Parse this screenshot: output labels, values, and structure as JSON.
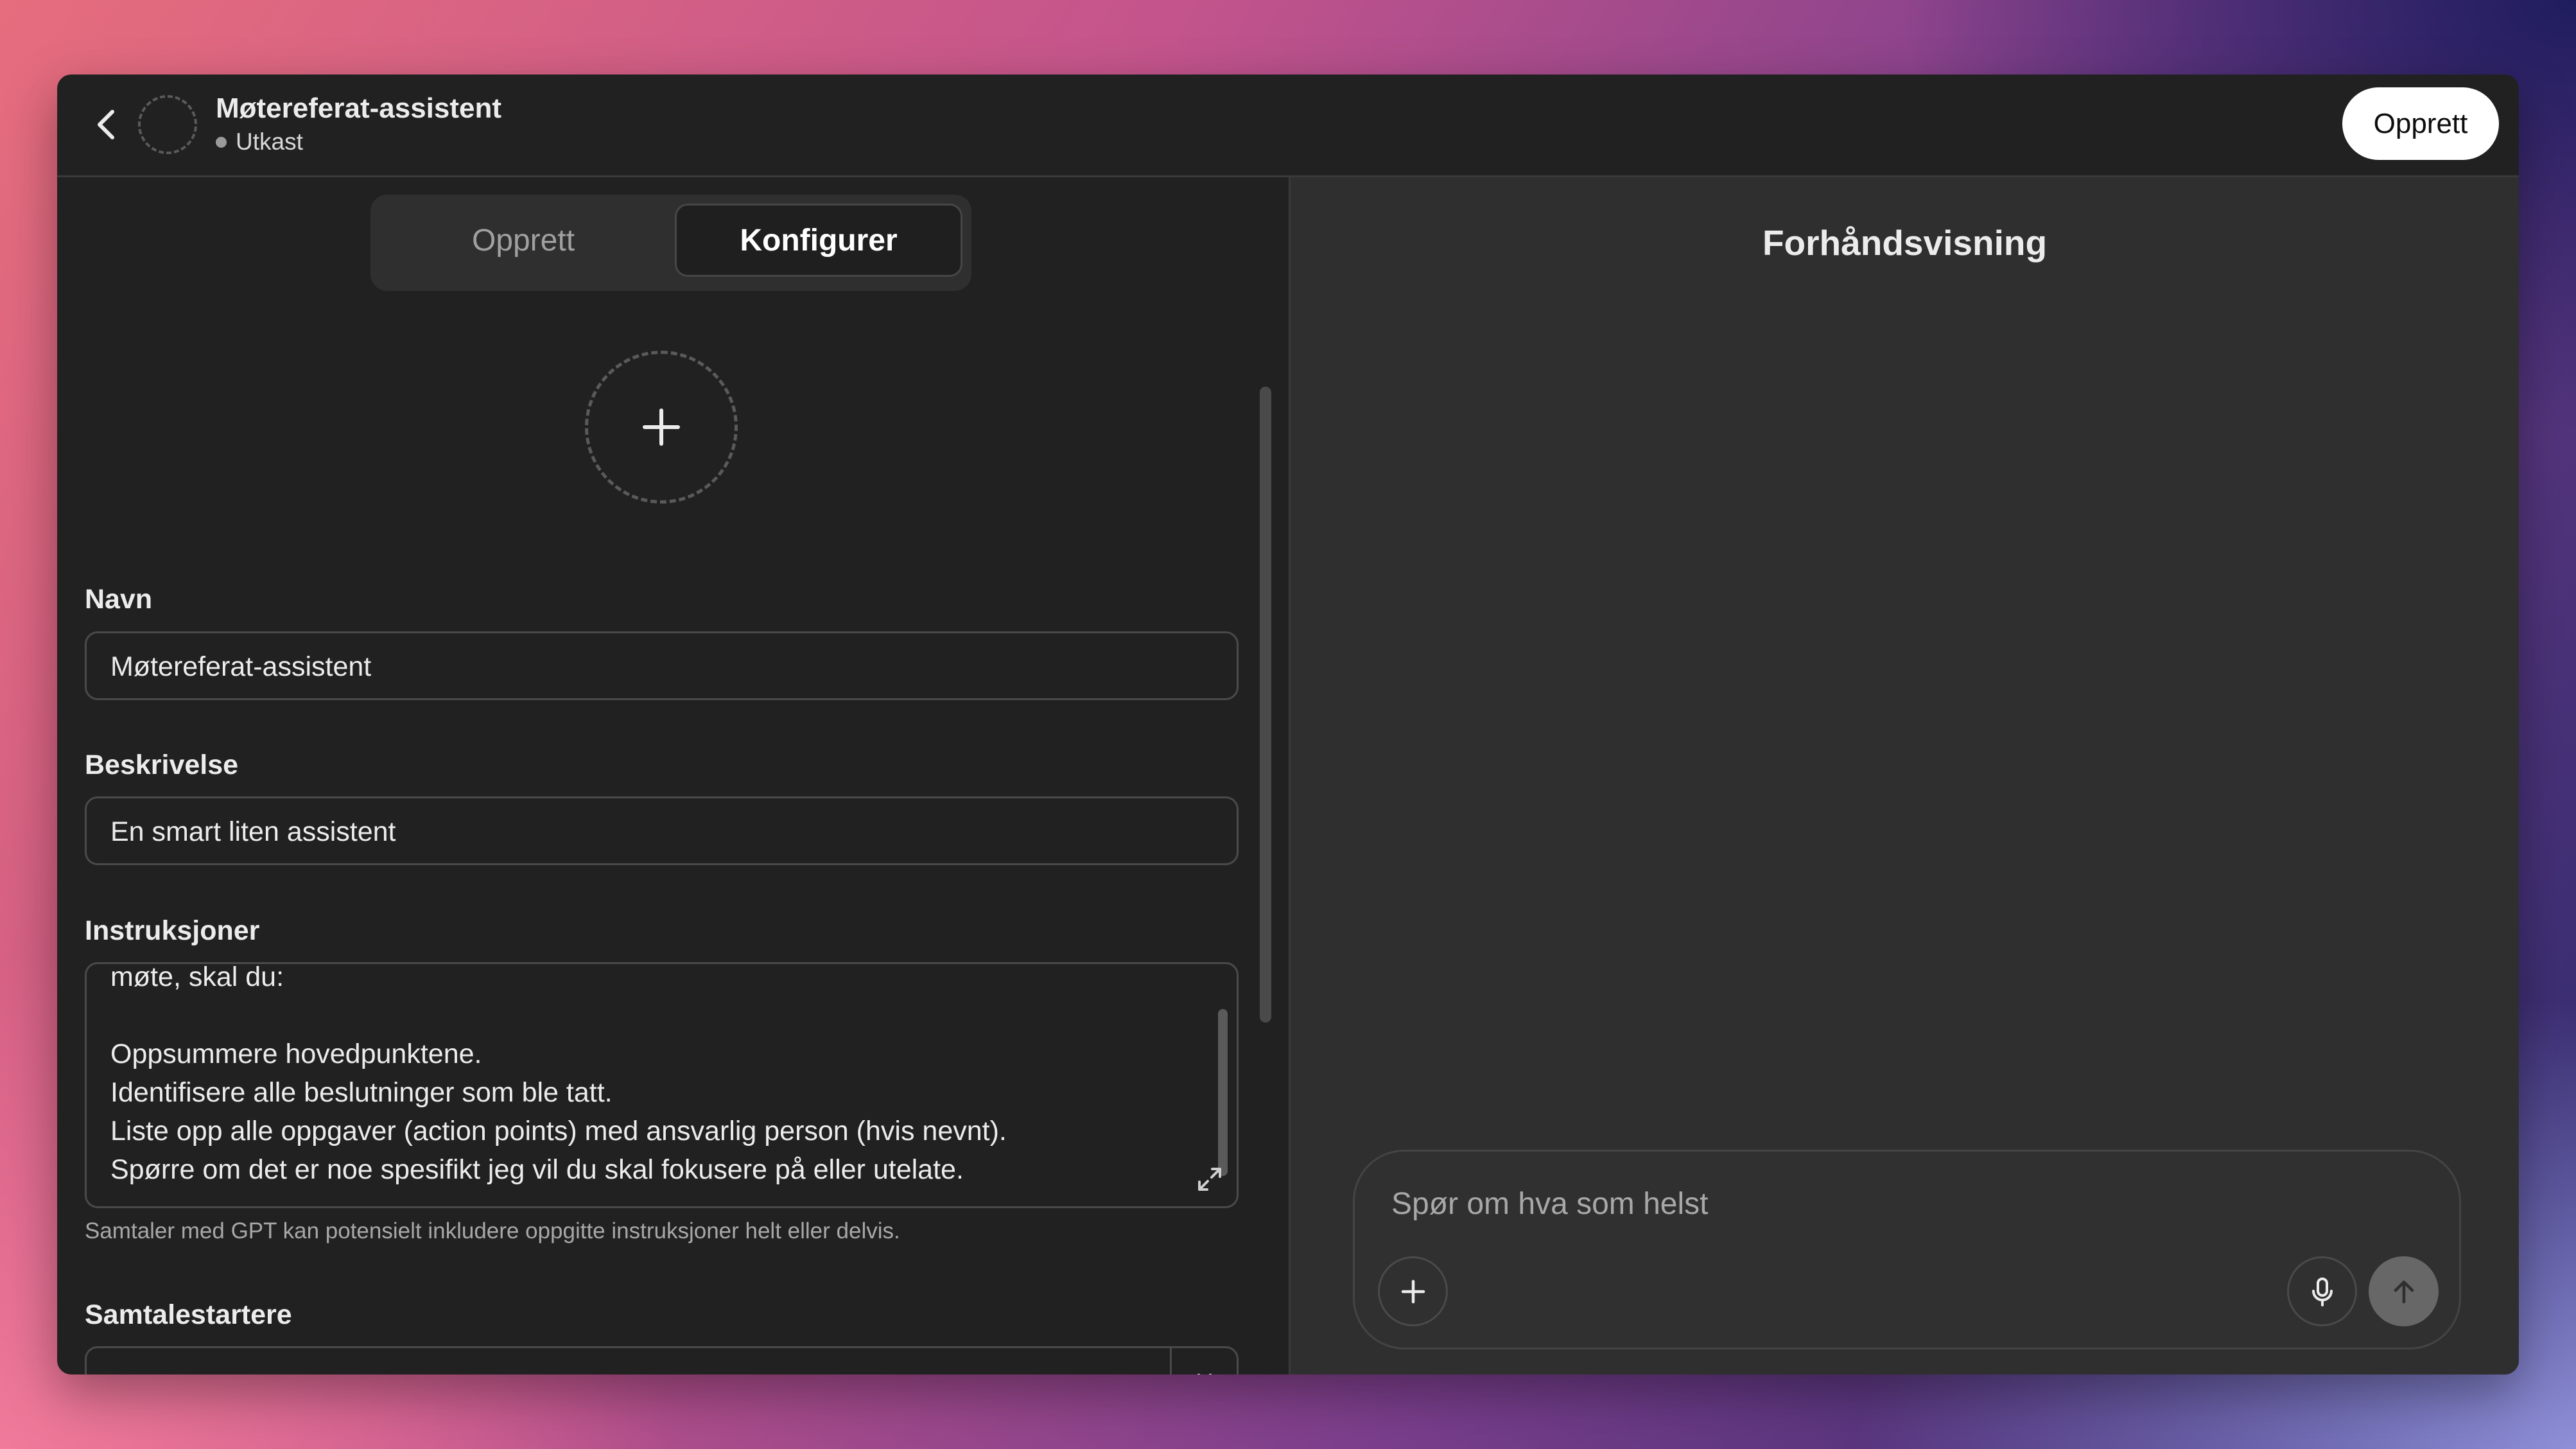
{
  "header": {
    "gpt_name": "Møtereferat-assistent",
    "status": "Utkast",
    "publish_label": "Opprett"
  },
  "tabs": {
    "create_label": "Opprett",
    "configure_label": "Konfigurer",
    "active": "Konfigurer"
  },
  "form": {
    "name_label": "Navn",
    "name_value": "Møtereferat-assistent",
    "description_label": "Beskrivelse",
    "description_value": "En smart liten assistent",
    "instructions_label": "Instruksjoner",
    "instructions_lines": [
      "møte, skal du:",
      "",
      "Oppsummere hovedpunktene.",
      "Identifisere alle beslutninger som ble tatt.",
      "Liste opp alle oppgaver (action points) med ansvarlig person (hvis nevnt).",
      "Spørre om det er noe spesifikt jeg vil du skal fokusere på eller utelate."
    ],
    "instructions_hint": "Samtaler med GPT kan potensielt inkludere oppgitte instruksjoner helt eller delvis.",
    "starters_label": "Samtalestartere",
    "starter_value": ""
  },
  "preview": {
    "title": "Forhåndsvisning",
    "composer_placeholder": "Spør om hva som helst"
  },
  "icons": {
    "back": "chevron-left-icon",
    "upload": "plus-icon",
    "expand": "expand-icon",
    "clear": "close-icon",
    "attach": "plus-icon",
    "mic": "microphone-icon",
    "send": "arrow-up-icon"
  },
  "colors": {
    "window_bg": "#212121",
    "preview_bg": "#2f2f2f",
    "publish_button_bg": "#ffffff",
    "send_button_bg": "#676767"
  }
}
